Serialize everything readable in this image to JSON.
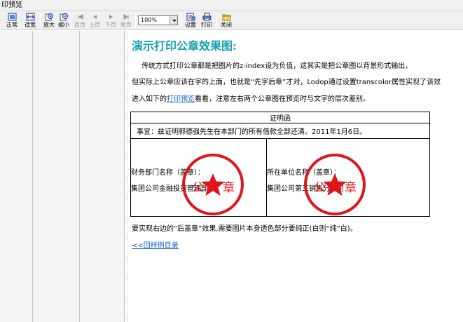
{
  "window": {
    "title": "印预览"
  },
  "toolbar": {
    "buttons": [
      {
        "id": "normal",
        "label": "正常",
        "icon": "page-normal-icon",
        "enabled": true
      },
      {
        "id": "fit",
        "label": "适宽",
        "icon": "page-fit-icon",
        "enabled": true
      },
      {
        "id": "zoom_in",
        "label": "放大",
        "icon": "zoom-in-icon",
        "enabled": true
      },
      {
        "id": "zoom_out",
        "label": "缩小",
        "icon": "zoom-out-icon",
        "enabled": true
      },
      {
        "id": "first",
        "label": "首页",
        "icon": "first-page-icon",
        "enabled": false
      },
      {
        "id": "prev",
        "label": "上页",
        "icon": "prev-page-icon",
        "enabled": false
      },
      {
        "id": "next",
        "label": "下页",
        "icon": "next-page-icon",
        "enabled": false
      },
      {
        "id": "last",
        "label": "尾页",
        "icon": "last-page-icon",
        "enabled": false
      },
      {
        "id": "setup",
        "label": "设置",
        "icon": "setup-icon",
        "enabled": true
      },
      {
        "id": "print",
        "label": "打印",
        "icon": "printer-icon",
        "enabled": true
      },
      {
        "id": "close",
        "label": "关闭",
        "icon": "close-folder-icon",
        "enabled": true
      }
    ],
    "zoom_value": "100%"
  },
  "content": {
    "heading": "演示打印公章效果图:",
    "para1": "传统方式打印公章都是把图片的z-index设为负值，这其实是把公章图以背景形式输出，",
    "para2": "但实际上公章应该在字的上面，也就是“先字后章”才对，Lodop通过设置transcolor属性实现了该效",
    "para3_before": "进入如下的",
    "para3_link": "打印预览",
    "para3_after": "看看，注意左右两个公章图在预览时与文字的层次差别。",
    "certificate": {
      "title": "证明函",
      "matter": "事宜：兹证明郭德强先生在本部门的所有借款全部还清。2011年1月6日。",
      "left_label": "财务部门名称（盖章）：",
      "left_value": "集团公司金融投资管理部",
      "right_label": "所在单位名称（盖章）：",
      "right_value": "集团公司第三销售分公司"
    },
    "seal_text": [
      "公",
      "章"
    ],
    "note": "要实现右边的“后盖章”效果,需要图片本身透色部分要纯正(白则“纯”白)。",
    "back_link": "<<回样例目录"
  },
  "colors": {
    "heading": "#17a0b4",
    "link": "#1a62d6",
    "seal": "#e0141b",
    "toolbar_bg": "#f0f0f0"
  }
}
